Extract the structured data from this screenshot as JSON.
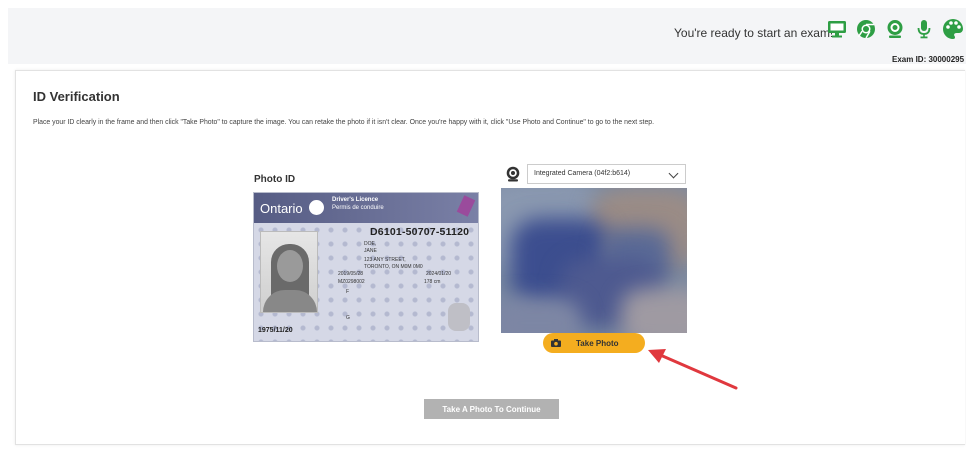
{
  "header": {
    "ready_text": "You're ready to start an exam!",
    "status_icons": [
      "monitor-icon",
      "chrome-icon",
      "webcam-icon",
      "microphone-icon",
      "palette-icon"
    ],
    "icon_color": "#2e9e44",
    "exam_id": "Exam ID: 30000295"
  },
  "main": {
    "title": "ID Verification",
    "instructions": "Place your ID clearly in the frame and then click \"Take Photo\" to capture the image. You can retake the photo if it isn't clear. Once you're happy with it, click \"Use Photo and Continue\" to go to the next step.",
    "photo_id_label": "Photo ID",
    "id_card": {
      "province": "Ontario",
      "licence_en": "Driver's Licence",
      "licence_fr": "Permis de conduire",
      "licence_number": "D6101-50707-51120",
      "surname": "DOE,",
      "given_name": "JANE",
      "street": "123 ANY STREET,",
      "city": "TORONTO, ON  M0M 0M0",
      "issued": "2019/05/28",
      "expiry": "2024/01/20",
      "dd_ref": "MZ0298002",
      "height": "178 cm",
      "sex": "F",
      "class": "G",
      "dob": "1975/11/20"
    },
    "camera": {
      "selected_device": "Integrated Camera (04f2:b614)",
      "take_photo_label": "Take Photo"
    },
    "continue_label": "Take A Photo To Continue",
    "accent_color": "#f4ad1f"
  }
}
